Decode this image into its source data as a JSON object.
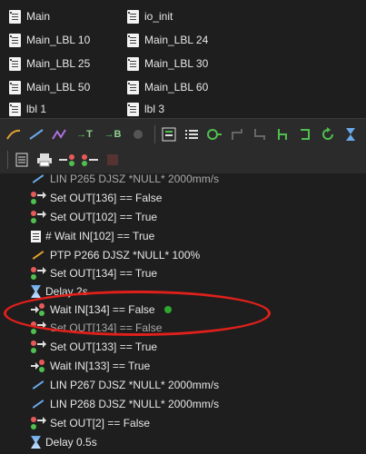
{
  "files": [
    {
      "label": "Main"
    },
    {
      "label": "io_init"
    },
    {
      "label": "Main_LBL 10"
    },
    {
      "label": "Main_LBL 24"
    },
    {
      "label": "Main_LBL 25"
    },
    {
      "label": "Main_LBL 30"
    },
    {
      "label": "Main_LBL 50"
    },
    {
      "label": "Main_LBL 60"
    },
    {
      "label": "lbl 1"
    },
    {
      "label": "lbl 3"
    }
  ],
  "toolbar": {
    "t_label": "T",
    "b_label": "B"
  },
  "program": [
    {
      "text": "LIN P265 DJSZ *NULL* 2000mm/s",
      "icon": "motion"
    },
    {
      "text": "Set OUT[136] == False",
      "icon": "io"
    },
    {
      "text": "Set OUT[102] == True",
      "icon": "io"
    },
    {
      "text": "# Wait IN[102] == True",
      "icon": "wait"
    },
    {
      "text": "PTP P266 DJSZ *NULL* 100%",
      "icon": "ptp"
    },
    {
      "text": "Set OUT[134] == True",
      "icon": "io"
    },
    {
      "text": "Delay 2s",
      "icon": "delay"
    },
    {
      "text": "Wait IN[134] == False",
      "icon": "waitin"
    },
    {
      "text": "Set OUT[134] == False",
      "icon": "io"
    },
    {
      "text": "Set OUT[133] == True",
      "icon": "io"
    },
    {
      "text": "Wait IN[133] == True",
      "icon": "waitin"
    },
    {
      "text": "LIN P267 DJSZ *NULL* 2000mm/s",
      "icon": "motion"
    },
    {
      "text": "LIN P268 DJSZ *NULL* 2000mm/s",
      "icon": "motion"
    },
    {
      "text": "Set OUT[2] == False",
      "icon": "io"
    },
    {
      "text": "Delay 0.5s",
      "icon": "delay"
    }
  ],
  "colors": {
    "highlight": "#e0201a",
    "active_dot": "#2ea82e"
  }
}
